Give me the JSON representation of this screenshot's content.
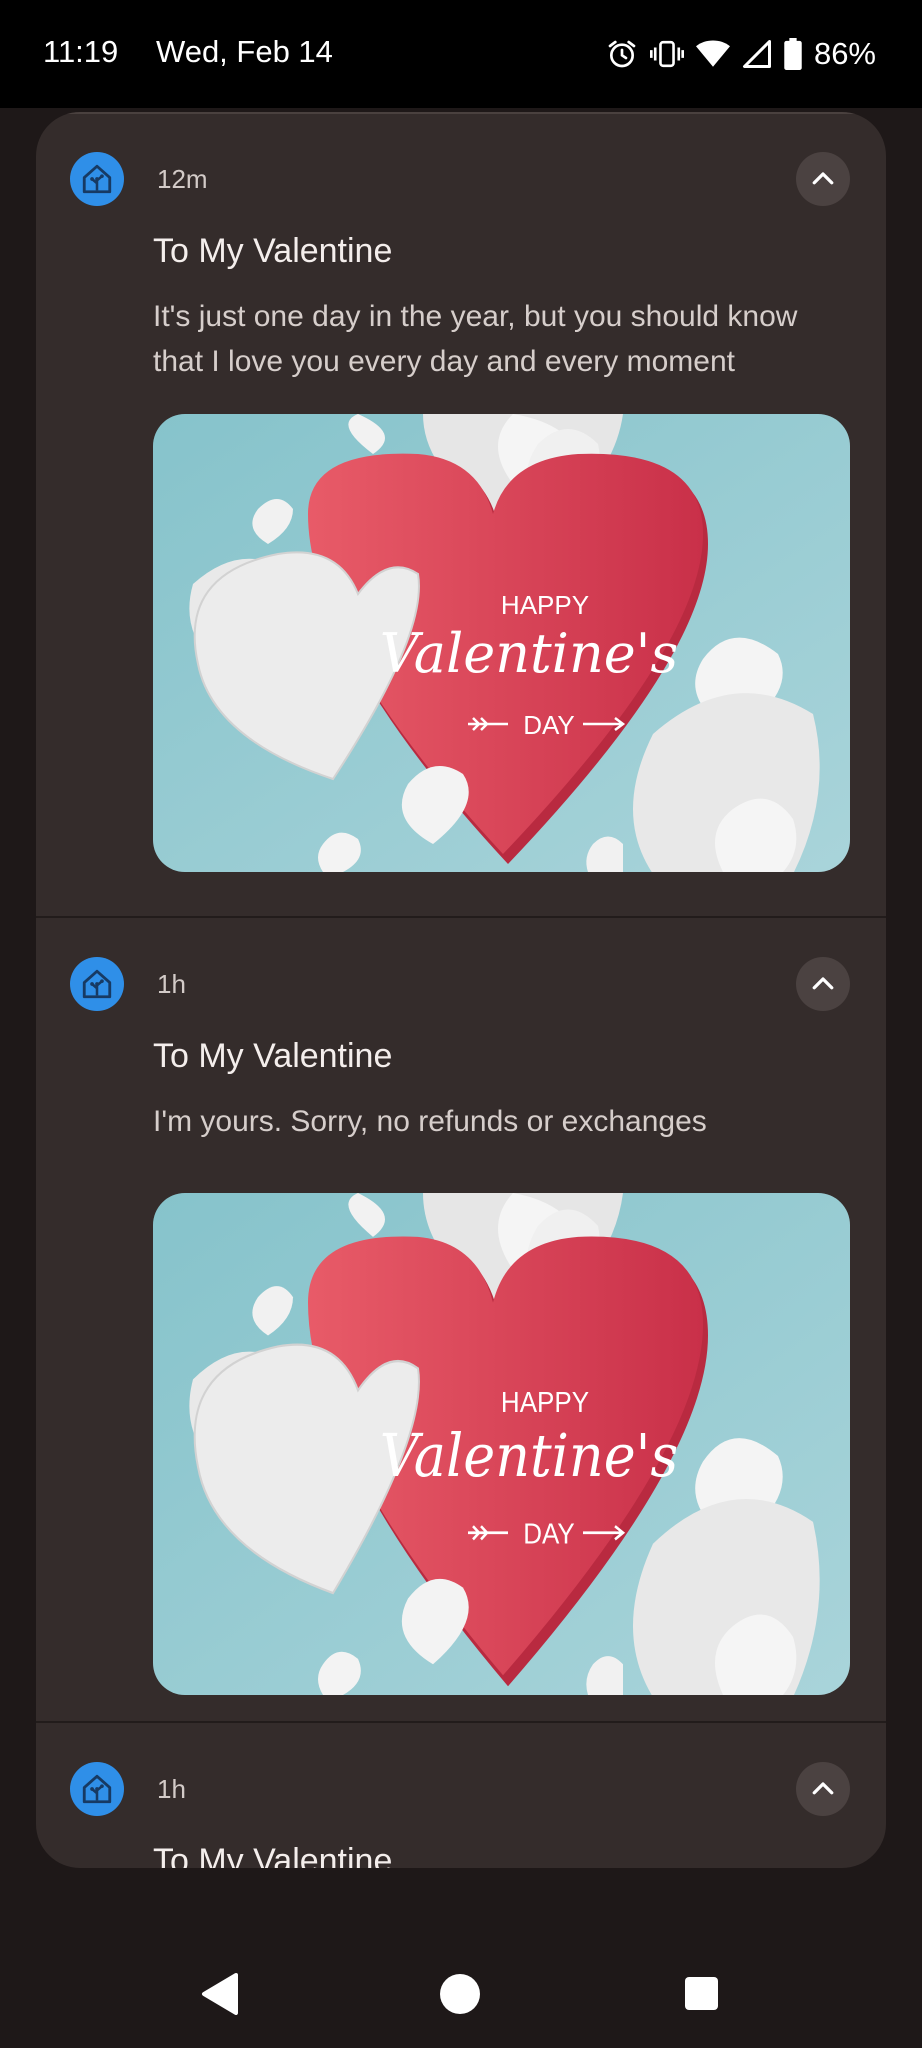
{
  "status_bar": {
    "time": "11:19",
    "date": "Wed, Feb 14",
    "battery": "86%",
    "icons": [
      "alarm-icon",
      "vibrate-icon",
      "wifi-icon",
      "cell-signal-icon",
      "battery-icon"
    ]
  },
  "notifications": [
    {
      "app_icon": "home-assistant-icon",
      "time": "12m",
      "title": "To My Valentine",
      "body": "It's just one day in the year, but you should know that I love you every day and every moment",
      "image": {
        "line1": "HAPPY",
        "line2": "Valentine's",
        "line3": "DAY"
      },
      "expand_icon": "chevron-up-icon"
    },
    {
      "app_icon": "home-assistant-icon",
      "time": "1h",
      "title": "To My Valentine",
      "body": "I'm yours. Sorry, no refunds or exchanges",
      "image": {
        "line1": "HAPPY",
        "line2": "Valentine's",
        "line3": "DAY"
      },
      "expand_icon": "chevron-up-icon"
    },
    {
      "app_icon": "home-assistant-icon",
      "time": "1h",
      "title": "To My Valentine",
      "expand_icon": "chevron-up-icon"
    }
  ],
  "nav_bar": {
    "icons": [
      "back-icon",
      "home-icon",
      "recents-icon"
    ]
  },
  "colors": {
    "panel": "#342c2b",
    "background": "#1e1818",
    "app_icon": "#2f8fe8",
    "heart": "#dc4255",
    "card_bg": "#9ccdd3"
  }
}
